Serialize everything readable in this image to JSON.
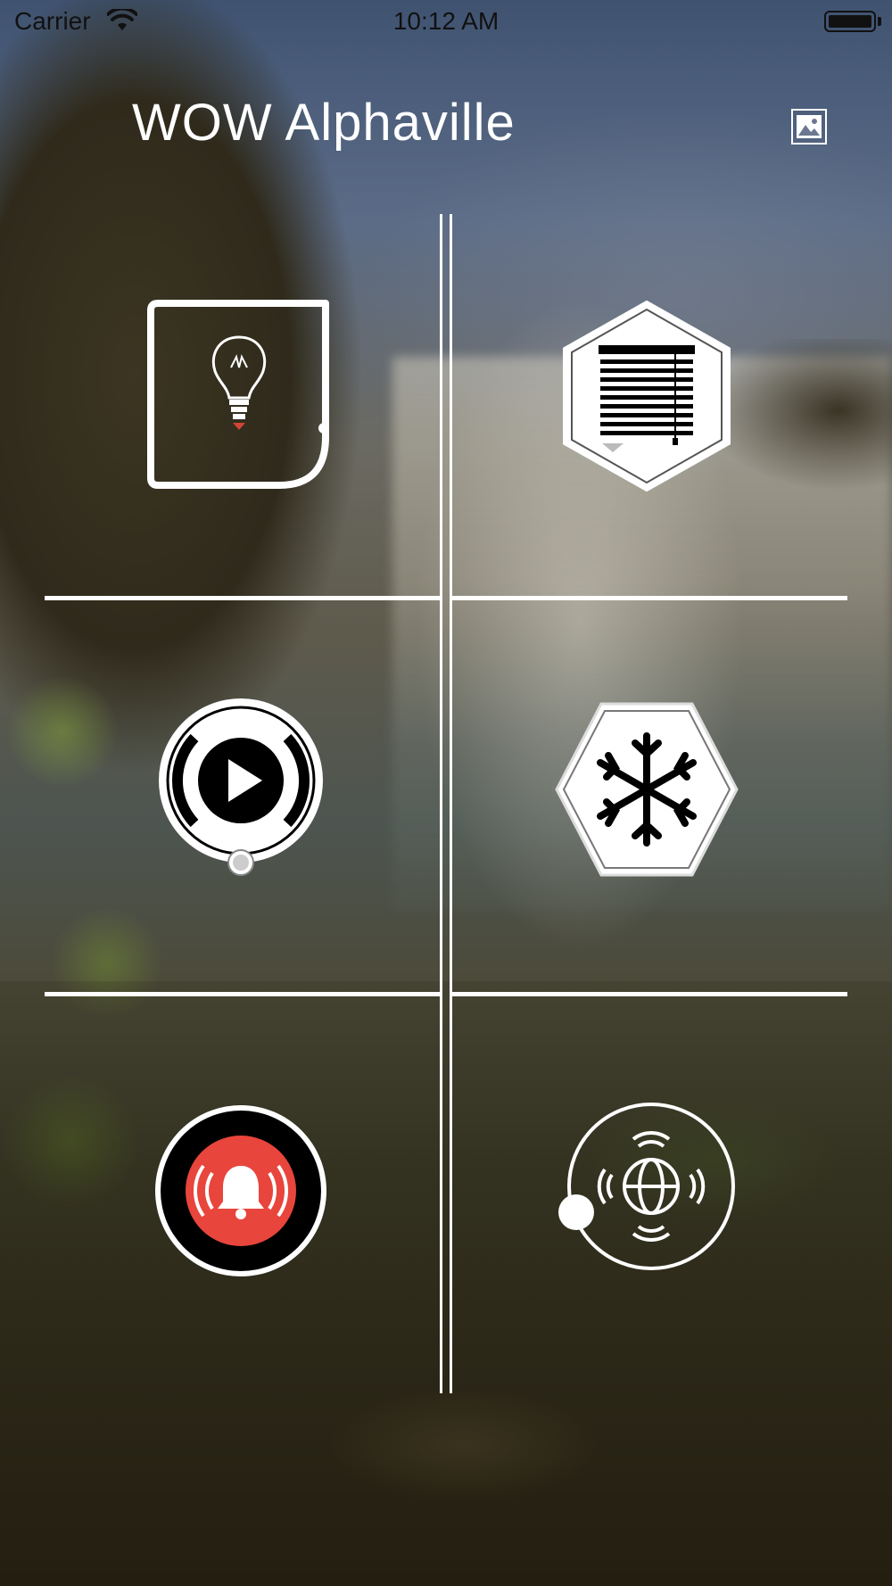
{
  "status_bar": {
    "carrier": "Carrier",
    "time": "10:12 AM",
    "wifi_icon": "wifi-icon",
    "battery_icon": "battery-icon"
  },
  "header": {
    "title": "WOW Alphaville",
    "wallpaper_icon": "image-icon"
  },
  "tiles": [
    {
      "name": "lighting",
      "icon": "lightbulb-icon"
    },
    {
      "name": "blinds",
      "icon": "window-blinds-icon"
    },
    {
      "name": "media",
      "icon": "play-icon"
    },
    {
      "name": "climate",
      "icon": "snowflake-icon"
    },
    {
      "name": "alarm",
      "icon": "alarm-bell-icon"
    },
    {
      "name": "sensors",
      "icon": "globe-signal-icon"
    }
  ],
  "colors": {
    "overlay_lines": "#ffffff",
    "alarm_red": "#e8453c",
    "icon_fill": "#000000"
  }
}
